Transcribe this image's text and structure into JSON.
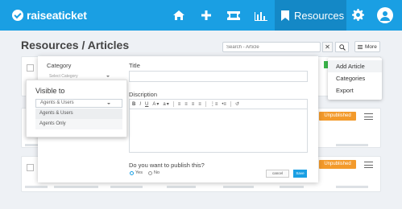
{
  "brand": {
    "name": "raiseaticket"
  },
  "nav": {
    "icons": [
      "home-icon",
      "plus-icon",
      "ticket-icon",
      "bar-chart-icon"
    ],
    "active_label": "Resources",
    "settings_icon": "gear-icon",
    "profile_icon": "user-icon"
  },
  "page": {
    "title": "Resources / Articles",
    "search_placeholder": "Search - Article",
    "clear_label": "✕",
    "more_label": "More"
  },
  "more_menu": {
    "items": [
      "Add Article",
      "Categories",
      "Export"
    ]
  },
  "cards": [
    {
      "status": ""
    },
    {
      "status": "Unpublished"
    },
    {
      "status": "Unpublished"
    }
  ],
  "modal": {
    "category_label": "Category",
    "category_placeholder": "Select Category",
    "title_label": "Title",
    "description_label": "Discription",
    "toolbar": [
      "B",
      "I",
      "U",
      "A",
      "▾",
      "a",
      "▾",
      "≡",
      "≡",
      "≡",
      "≡",
      "⋮≡",
      "•≡",
      "↺"
    ],
    "publish_question": "Do you want to  publish this?",
    "radio_yes": "Yes",
    "radio_no": "No",
    "cancel_label": "cancel",
    "save_label": "Save"
  },
  "visible_to": {
    "title": "Visible to",
    "selected": "Agents & Users",
    "options": [
      "Agents & Users",
      "Agents Only"
    ]
  },
  "colors": {
    "primary": "#1a9fe3",
    "primary_dark": "#1488c6",
    "unpublished": "#f39a2b",
    "background": "#eef1f5"
  }
}
